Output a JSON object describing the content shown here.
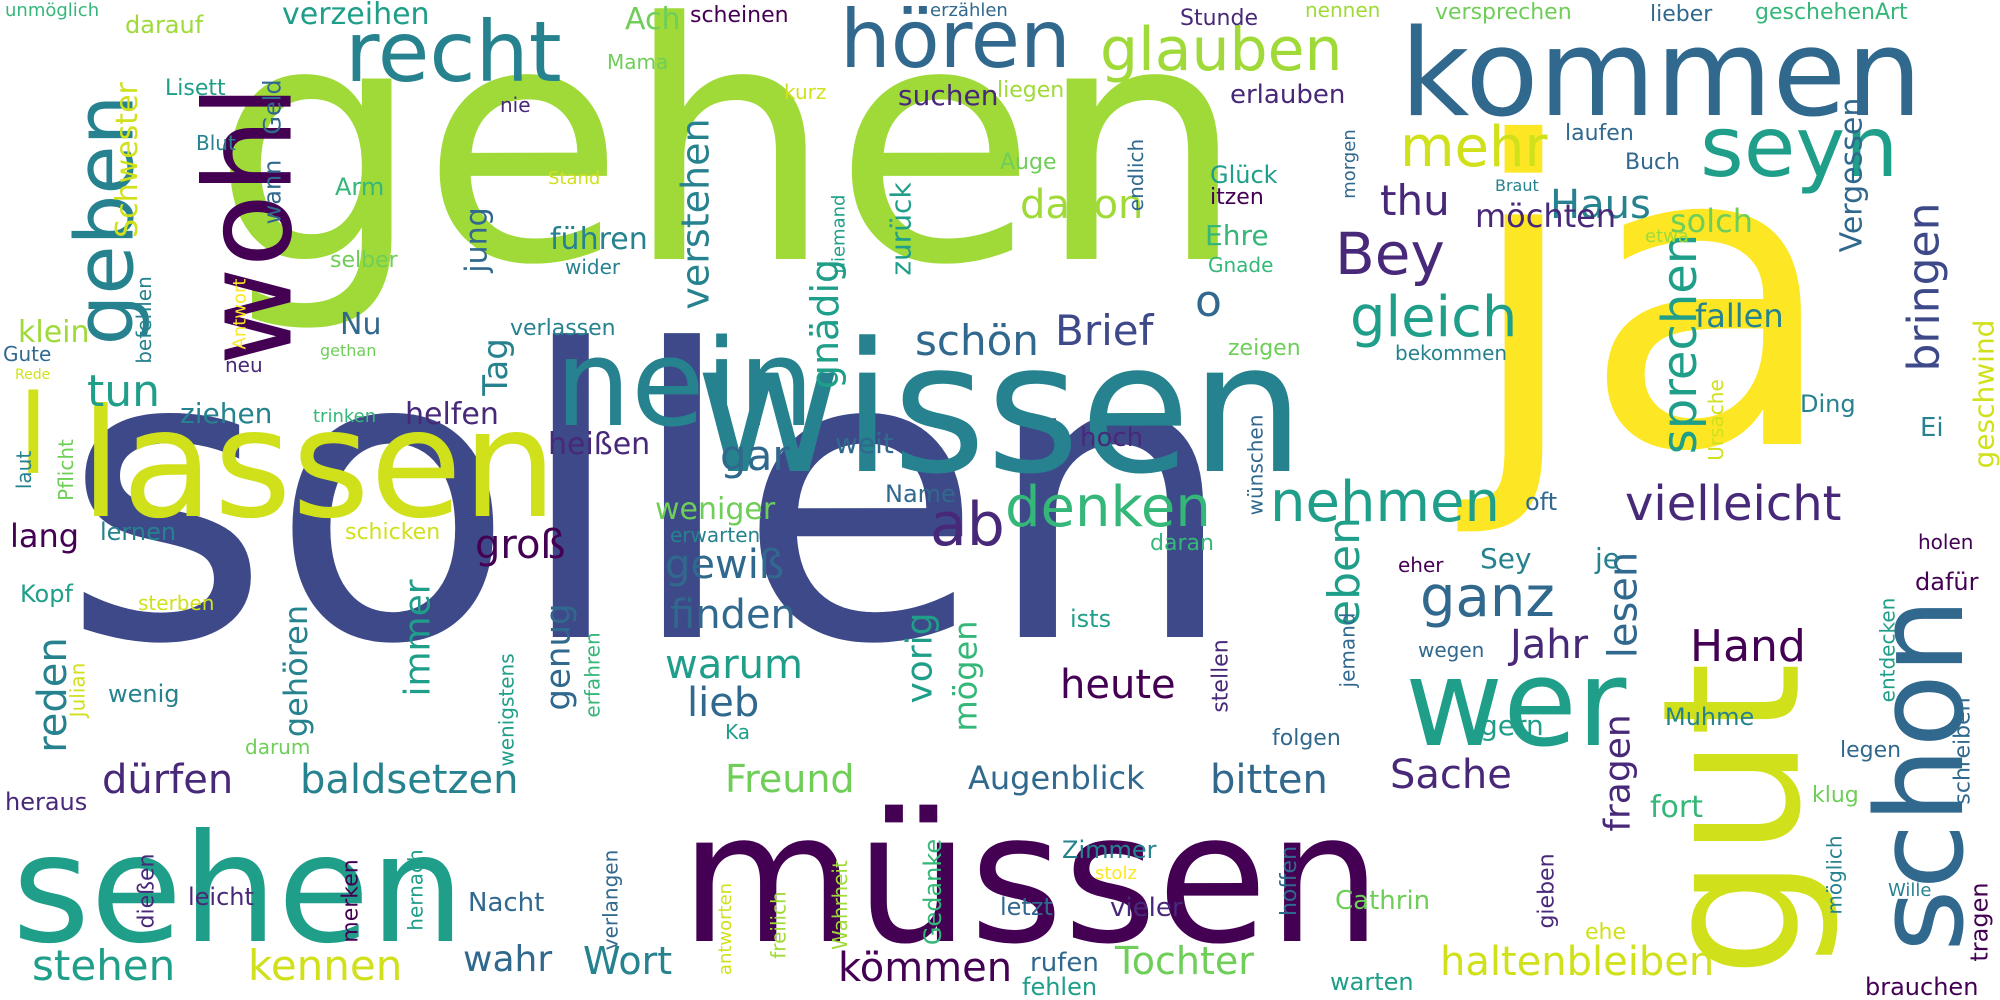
{
  "words": {
    "sollen": "sollen",
    "gehen": "gehen",
    "ja": "ja",
    "wissen": "wissen",
    "sehen": "sehen",
    "muessen": "müssen",
    "kommen": "kommen",
    "lassen": "lassen",
    "gut": "gut",
    "schon": "schon",
    "nein": "nein",
    "wohl": "wohl",
    "wer": "wer",
    "recht": "recht",
    "hoeren": "hören",
    "geben": "geben",
    "seyn": "seyn",
    "glauben": "glauben",
    "l": "l",
    "ab": "ab",
    "mehr": "mehr",
    "Bey": "Bey",
    "denken": "denken",
    "nehmen": "nehmen",
    "gleich": "gleich",
    "vielleicht": "vielleicht",
    "Haus": "Haus",
    "ganz": "ganz",
    "thu": "thu",
    "sprechen": "sprechen",
    "bringen": "bringen",
    "verstehen": "verstehen",
    "gnaedig": "gnädig",
    "Brief": "Brief",
    "schoen": "schön",
    "davon": "davon",
    "gar": "gar",
    "tun": "tun",
    "o": "o",
    "gewiss": "gewiß",
    "finden": "finden",
    "warum": "warum",
    "heute": "heute",
    "Hand": "Hand",
    "eben": "eben",
    "Jahr": "Jahr",
    "lesen": "lesen",
    "fragen": "fragen",
    "Sache": "Sache",
    "Freund": "Freund",
    "duerfen": "dürfen",
    "baldsetzen": "baldsetzen",
    "bitten": "bitten",
    "Augenblick": "Augenblick",
    "Tochter": "Tochter",
    "haltenbleiben": "haltenbleiben",
    "koemmen": "kömmen",
    "kennen": "kennen",
    "stehen": "stehen",
    "wahr": "wahr",
    "Wort": "Wort",
    "gross": "groß",
    "reden": "reden",
    "lieb": "lieb",
    "moegen": "mögen",
    "vorig": "vorig",
    "immer": "immer",
    "genug": "genug",
    "gehoeren": "gehören",
    "weniger": "weniger",
    "zurueck": "zurück",
    "fuehren": "führen",
    "suchen": "suchen",
    "moechten": "möchten",
    "solch": "solch",
    "Vergessen": "Vergessen",
    "fallen": "fallen",
    "Tag": "Tag",
    "Nu": "Nu",
    "jung": "jung",
    "Schwester": "Schwester",
    "klein": "klein",
    "ziehen": "ziehen",
    "helfen": "helfen",
    "heissen": "heißen",
    "weit": "weit",
    "erlauben": "erlauben",
    "Ehre": "Ehre",
    "Gluck": "Glück",
    "itzen": "itzen",
    "Sey": "Sey",
    "je": "je",
    "gern": "gern",
    "fort": "fort",
    "Muhme": "Muhme",
    "geschwind": "geschwind",
    "Ei": "Ei",
    "Ding": "Ding",
    "oft": "oft",
    "hoch": "hoch",
    "Name": "Name",
    "lang": "lang",
    "lernen": "lernen",
    "Kopf": "Kopf",
    "wenig": "wenig",
    "heraus": "heraus",
    "leicht": "leicht",
    "Nacht": "Nacht",
    "vieler": "vieler",
    "letzt": "letzt",
    "Zimmer": "Zimmer",
    "Cathrin": "Cathrin",
    "Gedanke": "Gedanke",
    "warten": "warten",
    "rufen": "rufen",
    "fehlen": "fehlen",
    "brauchen": "brauchen",
    "tragen": "tragen",
    "Wille": "Wille",
    "moeglich": "möglich",
    "schreiben": "schreiben",
    "holen": "holen",
    "dafuer": "dafür",
    "legen": "legen",
    "entdecken": "entdecken",
    "klug": "klug",
    "ehe": "ehe",
    "gieben": "gieben",
    "hoffen": "hoffen",
    "folgen": "folgen",
    "stellen": "stellen",
    "jemand": "jemand",
    "wegen": "wegen",
    "eher": "eher",
    "ists": "ists",
    "daran": "daran",
    "erwarten": "erwarten",
    "Ka": "Ka",
    "wenigstens": "wenigstens",
    "erfahren": "erfahren",
    "Julian": "Julian",
    "darum": "darum",
    "sterben": "sterben",
    "schicken": "schicken",
    "laut": "laut",
    "Pflicht": "Pflicht",
    "Gute": "Gute",
    "Rede": "Rede",
    "befehlen": "befehlen",
    "Antwort": "Antwort",
    "neu": "neu",
    "gethan": "gethan",
    "verlassen": "verlassen",
    "zeigen": "zeigen",
    "bekommen": "bekommen",
    "trinken": "trinken",
    "selber": "selber",
    "Arm": "Arm",
    "wann": "wann",
    "Geld": "Geld",
    "Stand": "Stand",
    "Blut": "Blut",
    "nie": "nie",
    "Lisett": "Lisett",
    "darauf": "darauf",
    "unmoeglich": "unmöglich",
    "Mama": "Mama",
    "Ach": "Ach",
    "scheinen": "scheinen",
    "erzaehlen": "erzählen",
    "kurz": "kurz",
    "liegen": "liegen",
    "Auge": "Auge",
    "endlich": "endlich",
    "niemand": "niemand",
    "wider": "wider",
    "Gnade": "Gnade",
    "Stunde": "Stunde",
    "nennen": "nennen",
    "versprechen": "versprechen",
    "lieber": "lieber",
    "geschehenArt": "geschehenArt",
    "laufen": "laufen",
    "Buch": "Buch",
    "Braut": "Braut",
    "etwa": "etwa",
    "morgen": "morgen",
    "wuenschen": "wünschen",
    "Ursache": "Ursache",
    "verzeihen": "verzeihen",
    "diessen": "dießen",
    "merken": "merken",
    "hernach": "hernach",
    "verlangen": "verlangen",
    "antworten": "antworten",
    "freilich": "freilich",
    "Wahrheit": "Wahrheit",
    "stolz": "stolz"
  }
}
